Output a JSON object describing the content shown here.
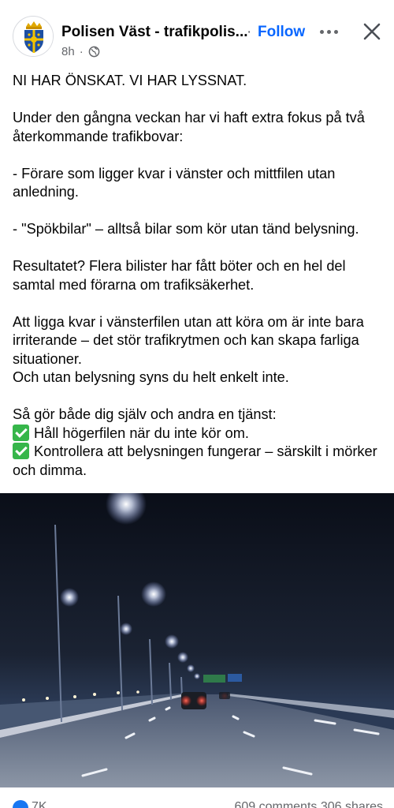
{
  "post": {
    "page_name": "Polisen Väst - trafikpolis...",
    "separator": "·",
    "follow_label": "Follow",
    "time": "8h",
    "privacy_icon": "globe-icon",
    "more_icon": "more-icon",
    "close_icon": "close-icon"
  },
  "content": {
    "heading": "NI HAR ÖNSKAT. VI HAR LYSSNAT.",
    "intro": "Under den gångna veckan har vi haft extra fokus på två återkommande trafikbovar:",
    "item1": "- Förare som ligger kvar i vänster och mittfilen utan anledning.",
    "item2": "- \"Spökbilar\" – alltså bilar som kör utan tänd belysning.",
    "result": "Resultatet? Flera bilister har fått böter och en hel del samtal med förarna om trafiksäkerhet.",
    "explain1": "Att ligga kvar i vänsterfilen utan att köra om är inte bara irriterande – det stör trafikrytmen och kan skapa farliga situationer.",
    "explain2": "Och utan belysning syns du helt enkelt inte.",
    "call": "Så gör både dig själv och andra en tjänst:",
    "tip1": "Håll högerfilen när du inte kör om.",
    "tip2": "Kontrollera att belysningen fungerar – särskilt i mörker och dimma."
  },
  "footer": {
    "reaction_count": "7K",
    "comments_shares": "609 comments  306 shares"
  },
  "colors": {
    "follow": "#0866ff",
    "secondary_text": "#65676b",
    "check_emoji": "#36b64a"
  }
}
